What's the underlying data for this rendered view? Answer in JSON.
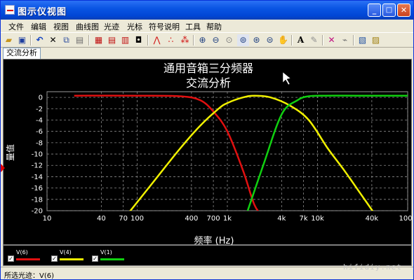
{
  "window": {
    "title": "图示仪视图"
  },
  "title_buttons": {
    "minimize": "_",
    "maximize": "□",
    "close": "✕"
  },
  "menu": [
    "文件",
    "编辑",
    "视图",
    "曲线图",
    "光迹",
    "光标",
    "符号说明",
    "工具",
    "帮助"
  ],
  "toolbar_icons": [
    "open-icon",
    "save-icon",
    "undo-icon",
    "cut-icon",
    "copy-icon",
    "paste-icon",
    "grid-icon",
    "legend-icon",
    "bars-icon",
    "window-icon",
    "trace-icon",
    "points-icon",
    "markers-icon",
    "zoom-in-icon",
    "zoom-out-icon",
    "zoom-icon",
    "zoom-fit-icon",
    "zoom-x-icon",
    "zoom-y-icon",
    "pan-icon",
    "text-icon",
    "pen-icon",
    "overlay-icon",
    "scope-icon",
    "export-icon",
    "print-icon"
  ],
  "tab": {
    "label": "交流分析"
  },
  "chart_data": {
    "type": "line",
    "title": "通用音箱三分频器",
    "subtitle": "交流分析",
    "xlabel": "频率 (Hz)",
    "ylabel": "量值",
    "x_scale": "log",
    "xlim": [
      10,
      100000
    ],
    "ylim": [
      -20,
      1
    ],
    "x_tick_labels": [
      "10",
      "40",
      "70",
      "100",
      "400",
      "700",
      "1k",
      "4k",
      "7k",
      "10k",
      "40k",
      "100k"
    ],
    "x_tick_values": [
      10,
      40,
      70,
      100,
      400,
      700,
      1000,
      4000,
      7000,
      10000,
      40000,
      100000
    ],
    "y_tick_values": [
      0,
      -2,
      -4,
      -6,
      -8,
      -10,
      -12,
      -14,
      -16,
      -18,
      -20
    ],
    "grid": true,
    "series": [
      {
        "name": "V(6)",
        "color": "#e01010",
        "x": [
          20,
          100,
          300,
          500,
          700,
          1000,
          1500,
          2000,
          2500
        ],
        "y": [
          0.3,
          0.3,
          0.2,
          -0.5,
          -2.5,
          -6,
          -13,
          -19,
          -21
        ]
      },
      {
        "name": "V(4)",
        "color": "#f0f000",
        "x": [
          75,
          150,
          300,
          500,
          800,
          1000,
          1500,
          2000,
          3000,
          5000,
          8000,
          13000,
          20000,
          30000,
          45000
        ],
        "y": [
          -21,
          -15,
          -9,
          -5,
          -2,
          -1,
          0,
          0.3,
          0,
          -1.5,
          -4,
          -9,
          -13,
          -17,
          -21
        ]
      },
      {
        "name": "V(1)",
        "color": "#10d010",
        "x": [
          1600,
          2500,
          4000,
          6000,
          8000,
          12000,
          30000,
          100000
        ],
        "y": [
          -21,
          -12,
          -3,
          -0.5,
          0.2,
          0.3,
          0.3,
          0.3
        ]
      }
    ]
  },
  "legend": [
    {
      "name": "V(6)",
      "color": "#e01010"
    },
    {
      "name": "V(4)",
      "color": "#f0f000"
    },
    {
      "name": "V(1)",
      "color": "#10d010"
    }
  ],
  "status": {
    "text": "所选光迹：V(6)"
  },
  "watermark": "hifidiy.net"
}
